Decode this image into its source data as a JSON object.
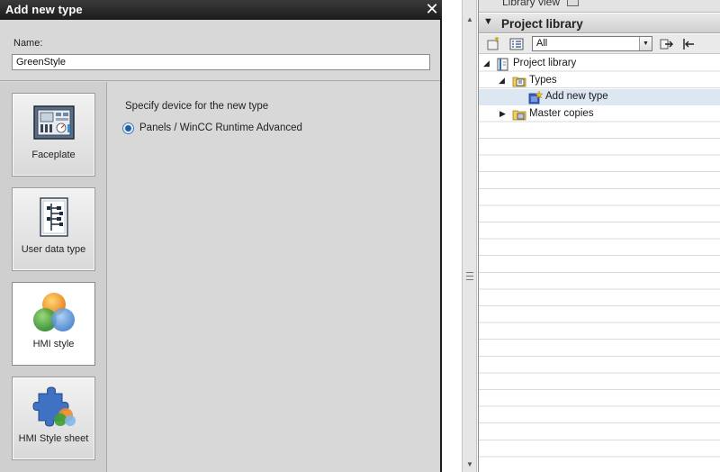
{
  "dialog": {
    "title": "Add new type",
    "close_glyph": "✕",
    "name_label": "Name:",
    "name_value": "GreenStyle",
    "types": [
      {
        "label": "Faceplate",
        "icon": "faceplate-icon",
        "selected": false
      },
      {
        "label": "User data type",
        "icon": "user-data-type-icon",
        "selected": false
      },
      {
        "label": "HMI style",
        "icon": "hmi-style-icon",
        "selected": true
      },
      {
        "label": "HMI Style sheet",
        "icon": "hmi-style-sheet-icon",
        "selected": false
      }
    ],
    "device_prompt": "Specify device for the new type",
    "device_option": "Panels / WinCC Runtime Advanced",
    "device_option_selected": true
  },
  "library": {
    "view_label": "Library view",
    "panel_title": "Project library",
    "filter_value": "All",
    "tree": [
      {
        "label": "Project library",
        "icon": "project-library-icon",
        "expanded": true,
        "selected": false
      },
      {
        "label": "Types",
        "icon": "types-folder-icon",
        "expanded": true,
        "selected": false
      },
      {
        "label": "Add new type",
        "icon": "add-new-type-icon",
        "expanded": null,
        "selected": true
      },
      {
        "label": "Master copies",
        "icon": "master-copies-folder-icon",
        "expanded": false,
        "selected": false
      }
    ]
  },
  "colors": {
    "title_bar": "#1c1c1c",
    "dialog_bg": "#d8d8d8",
    "selection": "#dce7f1",
    "radio_accent": "#1e5e99"
  }
}
